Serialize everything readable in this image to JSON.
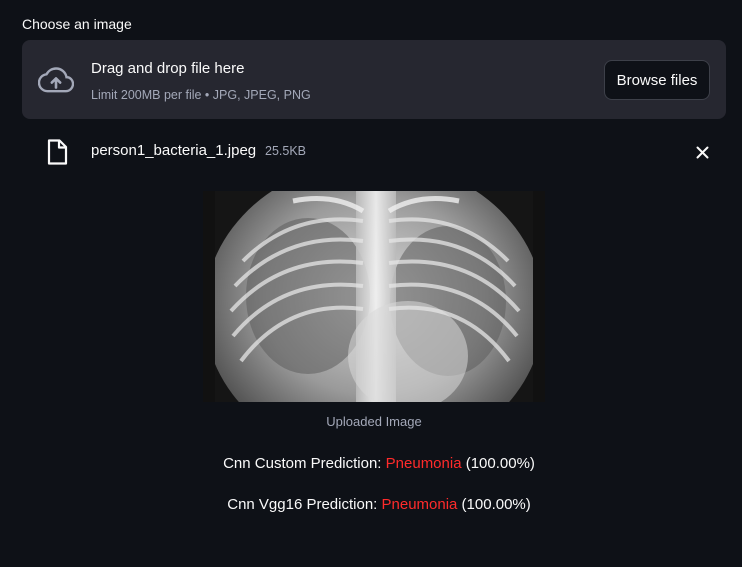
{
  "uploader": {
    "label": "Choose an image",
    "drop_title": "Drag and drop file here",
    "drop_subtitle": "Limit 200MB per file • JPG, JPEG, PNG",
    "browse_label": "Browse files"
  },
  "file": {
    "name": "person1_bacteria_1.jpeg",
    "size": "25.5KB"
  },
  "image": {
    "caption": "Uploaded Image"
  },
  "predictions": [
    {
      "prefix": "Cnn Custom Prediction: ",
      "label": "Pneumonia",
      "confidence": " (100.00%)"
    },
    {
      "prefix": "Cnn Vgg16 Prediction: ",
      "label": "Pneumonia",
      "confidence": " (100.00%)"
    }
  ],
  "colors": {
    "background": "#0e1117",
    "dropzone": "#262730",
    "prediction_label": "#ff2b2b"
  }
}
